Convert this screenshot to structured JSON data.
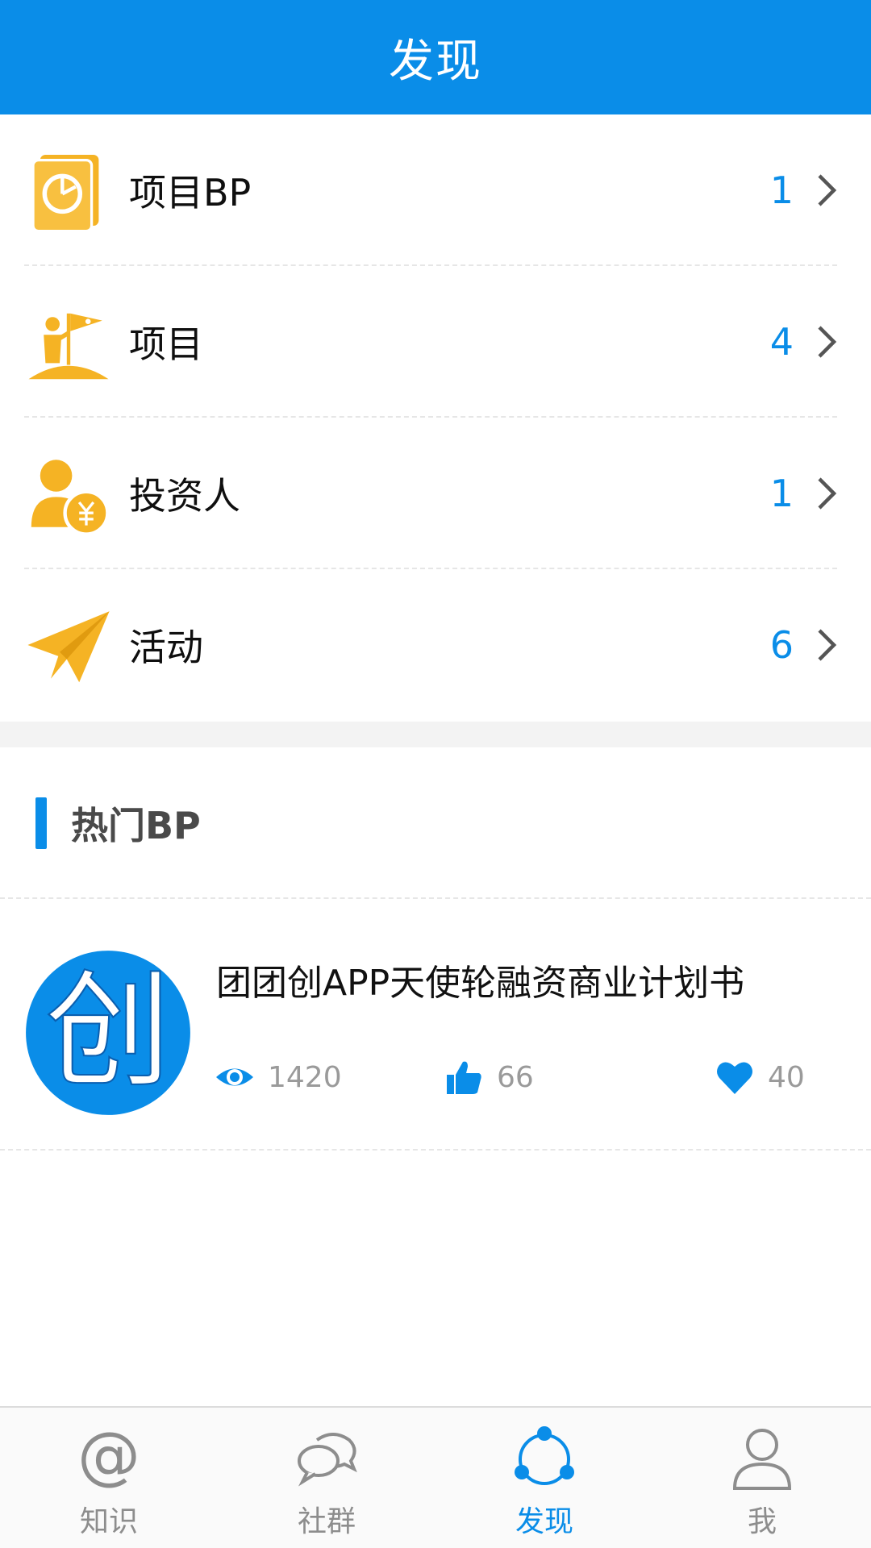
{
  "header": {
    "title": "发现"
  },
  "menu": {
    "items": [
      {
        "label": "项目BP",
        "count": "1",
        "icon": "bp-book-icon"
      },
      {
        "label": "项目",
        "count": "4",
        "icon": "flag-person-icon"
      },
      {
        "label": "投资人",
        "count": "1",
        "icon": "investor-yen-icon"
      },
      {
        "label": "活动",
        "count": "6",
        "icon": "paper-plane-icon"
      }
    ]
  },
  "hot": {
    "title": "热门BP",
    "items": [
      {
        "title": "团团创APP天使轮融资商业计划书",
        "logo_text": "创",
        "views": "1420",
        "likes": "66",
        "favorites": "40"
      }
    ]
  },
  "tabbar": {
    "items": [
      {
        "label": "知识",
        "icon": "at-icon"
      },
      {
        "label": "社群",
        "icon": "chat-bubbles-icon"
      },
      {
        "label": "发现",
        "icon": "discover-icon",
        "active": true
      },
      {
        "label": "我",
        "icon": "user-icon"
      }
    ]
  },
  "colors": {
    "primary": "#0a8de8",
    "accent": "#f5b324",
    "muted": "#9a9a9a"
  }
}
